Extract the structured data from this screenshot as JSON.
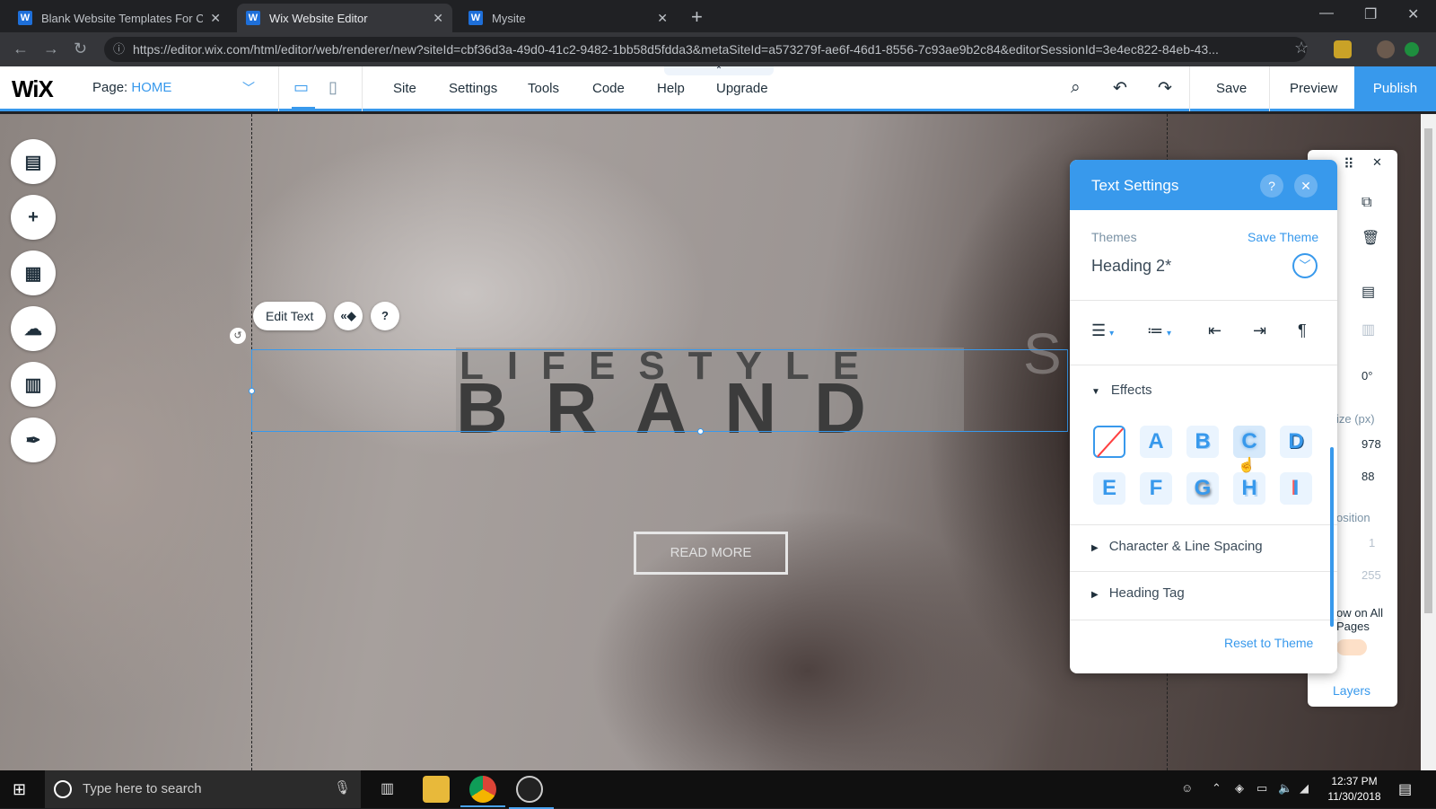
{
  "browser": {
    "tabs": [
      {
        "label": "Blank Website Templates For Cre",
        "active": false
      },
      {
        "label": "Wix Website Editor",
        "active": true
      },
      {
        "label": "Mysite",
        "active": false
      }
    ],
    "url": "https://editor.wix.com/html/editor/web/renderer/new?siteId=cbf36d3a-49d0-41c2-9482-1bb58d5fdda3&metaSiteId=a573279f-ae6f-46d1-8556-7c93ae9b2c84&editorSessionId=3e4ec822-84eb-43..."
  },
  "wixbar": {
    "logo": "WiX",
    "page_label": "Page:",
    "page_value": "HOME",
    "menu": [
      "Site",
      "Settings",
      "Tools",
      "Code",
      "Help",
      "Upgrade"
    ],
    "save": "Save",
    "preview": "Preview",
    "publish": "Publish"
  },
  "canvas": {
    "edit_text": "Edit Text",
    "heading_line1": "LIFESTYLE",
    "heading_line2": "BRAND",
    "read_more": "READ MORE"
  },
  "right_panel": {
    "rotation": "0°",
    "size_label": "ize (px)",
    "width": "978",
    "height": "88",
    "position_label": "osition",
    "pos_x": "1",
    "pos_y": "255",
    "show_all_pages": "ow on All Pages",
    "layers": "Layers"
  },
  "text_settings": {
    "title": "Text Settings",
    "themes_label": "Themes",
    "save_theme": "Save Theme",
    "theme_value": "Heading 2*",
    "effects_label": "Effects",
    "effects": [
      "A",
      "B",
      "C",
      "D",
      "E",
      "F",
      "G",
      "H",
      "I"
    ],
    "char_spacing": "Character & Line Spacing",
    "heading_tag": "Heading Tag",
    "reset": "Reset to Theme"
  },
  "taskbar": {
    "search_placeholder": "Type here to search",
    "time": "12:37 PM",
    "date": "11/30/2018"
  },
  "colors": {
    "accent": "#3899ec",
    "taskbar": "#101010",
    "chrome_dark": "#202124"
  }
}
